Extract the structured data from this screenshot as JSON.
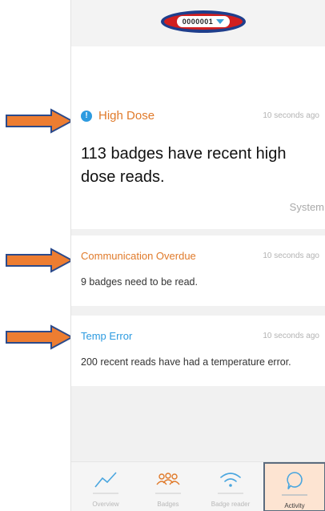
{
  "device_selector": {
    "value": "0000001",
    "caret_icon": "caret-down-icon"
  },
  "notifications": [
    {
      "title": "High Dose",
      "time": "10 seconds ago",
      "message": "113 badges have recent high dose reads.",
      "source": "System",
      "icon": "info-icon",
      "title_color": "#e07a2a"
    },
    {
      "title": "Communication Overdue",
      "time": "10 seconds ago",
      "message": "9 badges need to be read.",
      "title_color": "#e07a2a"
    },
    {
      "title": "Temp Error",
      "time": "10 seconds ago",
      "message": "200 recent reads have had a temperature error.",
      "title_color": "#2d9be0"
    }
  ],
  "tabs": [
    {
      "label": "Overview",
      "icon": "line-chart-icon"
    },
    {
      "label": "Badges",
      "icon": "badges-icon"
    },
    {
      "label": "Badge reader",
      "icon": "wifi-icon"
    },
    {
      "label": "Activity",
      "icon": "speech-bubble-icon",
      "active": true
    }
  ],
  "colors": {
    "accent_orange": "#e07a2a",
    "accent_blue": "#2d9be0",
    "annotation_arrow": "#ed7d31",
    "annotation_outline": "#1f3e8c",
    "annotation_fill": "#d21f1f"
  }
}
